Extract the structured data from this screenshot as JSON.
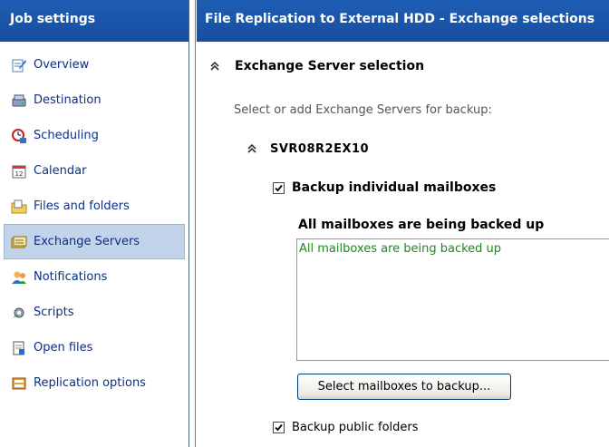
{
  "sidebar": {
    "title": "Job settings",
    "items": [
      {
        "label": "Overview",
        "icon": "overview-icon"
      },
      {
        "label": "Destination",
        "icon": "destination-icon"
      },
      {
        "label": "Scheduling",
        "icon": "scheduling-icon"
      },
      {
        "label": "Calendar",
        "icon": "calendar-icon"
      },
      {
        "label": "Files and folders",
        "icon": "files-folders-icon"
      },
      {
        "label": "Exchange Servers",
        "icon": "exchange-servers-icon",
        "selected": true
      },
      {
        "label": "Notifications",
        "icon": "notifications-icon"
      },
      {
        "label": "Scripts",
        "icon": "scripts-icon"
      },
      {
        "label": "Open files",
        "icon": "open-files-icon"
      },
      {
        "label": "Replication options",
        "icon": "replication-options-icon"
      }
    ]
  },
  "main": {
    "title": "File Replication to External HDD - Exchange selections",
    "section": {
      "title": "Exchange Server selection",
      "description": "Select or add Exchange Servers for backup:"
    },
    "server": {
      "name": "SVR08R2EX10",
      "backup_mailboxes_label": "Backup individual mailboxes",
      "backup_mailboxes_checked": true,
      "mailboxes_title": "All mailboxes are being backed up",
      "mailboxes_list_text": "All mailboxes are being backed up",
      "select_button_label": "Select mailboxes to backup...",
      "backup_public_label": "Backup public folders",
      "backup_public_checked": true
    }
  },
  "colors": {
    "header_bg": "#1a56ab",
    "selected_bg": "#c3d3ea",
    "link_text": "#0b2f87",
    "mailbox_text": "#1c8a1c"
  }
}
